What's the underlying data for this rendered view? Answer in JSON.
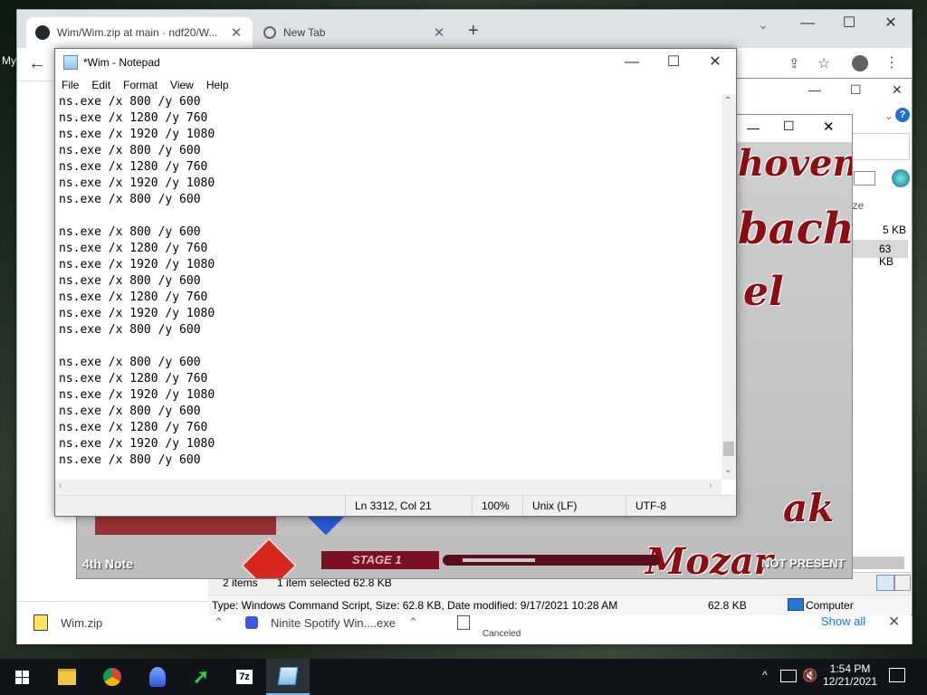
{
  "desktop": {
    "label_left": "My"
  },
  "chrome": {
    "tabs": [
      {
        "title": "Wim/Wim.zip at main · ndf20/W...",
        "icon": "github-icon"
      },
      {
        "title": "New Tab",
        "icon": "chrome-icon"
      }
    ],
    "downloads": [
      {
        "name": "Wim.zip",
        "status": ""
      },
      {
        "name": "Ninite Spotify Win....exe",
        "status": ""
      },
      {
        "name": "",
        "status": "Canceled"
      }
    ],
    "show_all": "Show all"
  },
  "explorer": {
    "col_size": "ize",
    "sizes": [
      "5 KB",
      "63 KB"
    ],
    "items_count": "2 items",
    "selected": "1 item selected  62.8 KB",
    "details": "Type: Windows Command Script, Size: 62.8 KB, Date modified: 9/17/2021 10:28 AM",
    "details_size": "62.8 KB",
    "location": "Computer"
  },
  "game": {
    "words": [
      "hoven",
      "bach",
      "el",
      "ak",
      "Mozar"
    ],
    "note_label": "4th Note",
    "stage_label": "STAGE 1",
    "not_present": "NOT PRESENT"
  },
  "notepad": {
    "title": "*Wim - Notepad",
    "menu": [
      "File",
      "Edit",
      "Format",
      "View",
      "Help"
    ],
    "lines": [
      "ns.exe /x 800 /y 600",
      "ns.exe /x 1280 /y 760",
      "ns.exe /x 1920 /y 1080",
      "ns.exe /x 800 /y 600",
      "ns.exe /x 1280 /y 760",
      "ns.exe /x 1920 /y 1080",
      "ns.exe /x 800 /y 600",
      "",
      "ns.exe /x 800 /y 600",
      "ns.exe /x 1280 /y 760",
      "ns.exe /x 1920 /y 1080",
      "ns.exe /x 800 /y 600",
      "ns.exe /x 1280 /y 760",
      "ns.exe /x 1920 /y 1080",
      "ns.exe /x 800 /y 600",
      "",
      "ns.exe /x 800 /y 600",
      "ns.exe /x 1280 /y 760",
      "ns.exe /x 1920 /y 1080",
      "ns.exe /x 800 /y 600",
      "ns.exe /x 1280 /y 760",
      "ns.exe /x 1920 /y 1080",
      "ns.exe /x 800 /y 600"
    ],
    "status": {
      "position": "Ln 3312, Col 21",
      "zoom": "100%",
      "line_ending": "Unix (LF)",
      "encoding": "UTF-8"
    }
  },
  "taskbar": {
    "apps": [
      "windows-start-icon",
      "file-explorer-icon",
      "chrome-icon",
      "browser-shell-icon",
      "arrow-app-icon",
      "7zip-icon",
      "notepad-icon"
    ],
    "time": "1:54 PM",
    "date": "12/21/2021"
  }
}
